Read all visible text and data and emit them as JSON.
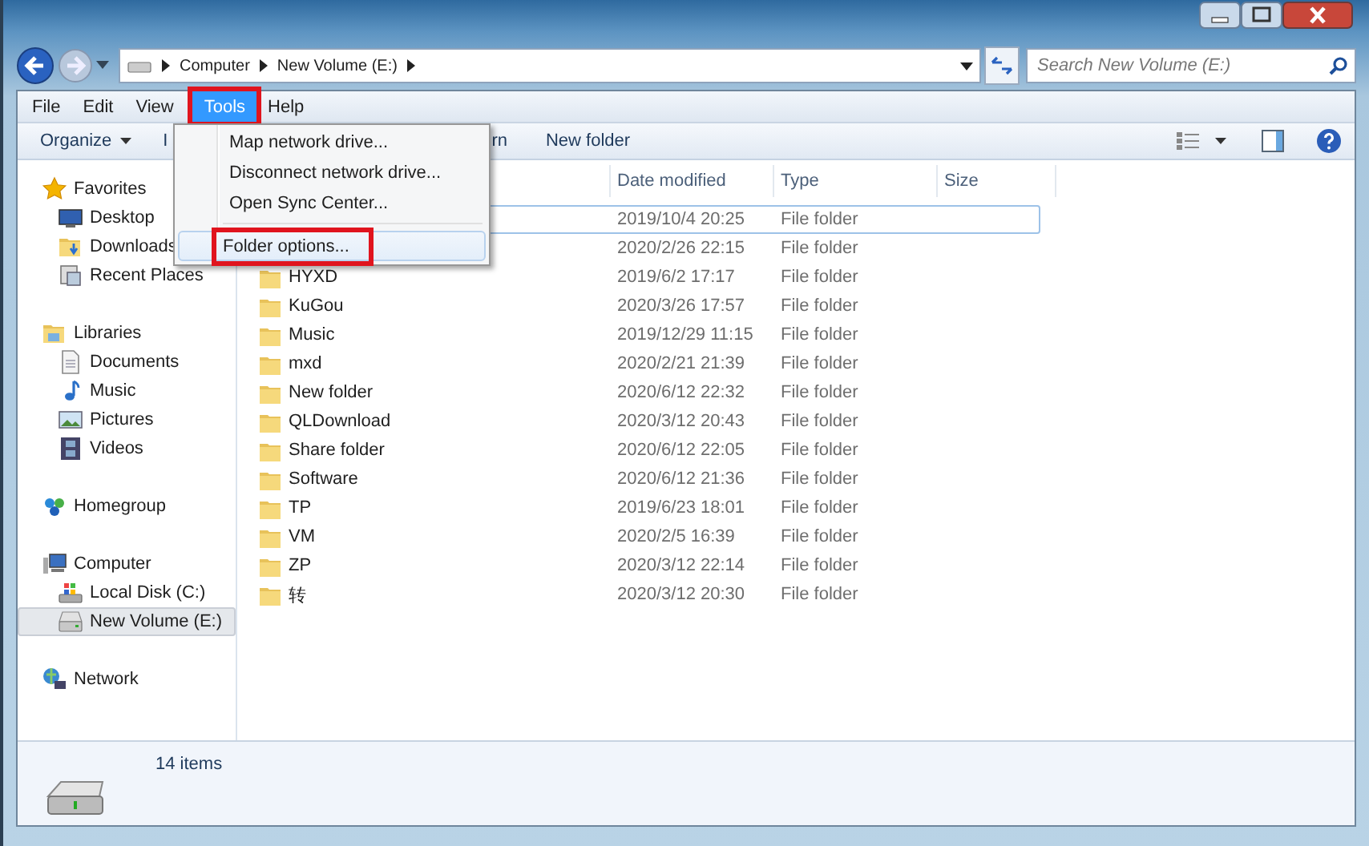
{
  "address_bar": {
    "crumbs": [
      "Computer",
      "New Volume (E:)"
    ]
  },
  "search": {
    "placeholder": "Search New Volume (E:)"
  },
  "menu_bar": [
    {
      "label": "File",
      "selected": false,
      "outlined": false
    },
    {
      "label": "View",
      "selected": false,
      "outlined": false
    },
    {
      "label": "Tools",
      "selected": true,
      "outlined": true
    },
    {
      "label": "Help",
      "selected": false,
      "outlined": false
    }
  ],
  "menu_bar_extra": {
    "label": "Edit"
  },
  "toolbar": [
    {
      "label": "Organize",
      "kind": "dropdown"
    },
    {
      "label": "I",
      "kind": "plain"
    },
    {
      "label": "rn",
      "kind": "plain"
    },
    {
      "label": "New folder",
      "kind": "plain"
    }
  ],
  "tools_menu": [
    {
      "kind": "item",
      "label": "Map network drive...",
      "highlighted": false,
      "outlined": false
    },
    {
      "kind": "item",
      "label": "Disconnect network drive...",
      "highlighted": false,
      "outlined": false
    },
    {
      "kind": "item",
      "label": "Open Sync Center...",
      "highlighted": false,
      "outlined": false
    },
    {
      "kind": "separator"
    },
    {
      "kind": "item",
      "label": "Folder options...",
      "highlighted": true,
      "outlined": true
    }
  ],
  "sidebar": [
    {
      "label": "Favorites",
      "selected": false,
      "children": [
        {
          "label": "Desktop",
          "selected": false
        },
        {
          "label": "Downloads",
          "selected": false
        },
        {
          "label": "Recent Places",
          "selected": false
        }
      ]
    },
    {
      "label": "Libraries",
      "selected": false,
      "children": [
        {
          "label": "Documents",
          "selected": false
        },
        {
          "label": "Music",
          "selected": false
        },
        {
          "label": "Pictures",
          "selected": false
        },
        {
          "label": "Videos",
          "selected": false
        }
      ]
    },
    {
      "label": "Homegroup",
      "selected": false
    },
    {
      "label": "Computer",
      "selected": false,
      "children": [
        {
          "label": "Local Disk (C:)",
          "selected": false
        },
        {
          "label": "New Volume (E:)",
          "selected": true
        }
      ]
    },
    {
      "label": "Network",
      "selected": false
    }
  ],
  "table": {
    "columns": [
      "Date modified",
      "Type",
      "Size"
    ],
    "rows": [
      {
        "modified": "2019/10/4 20:25",
        "type": "File folder",
        "selected": true
      },
      {
        "modified": "2020/2/26 22:15",
        "type": "File folder",
        "selected": false
      },
      {
        "name": "HYXD",
        "modified": "2019/6/2 17:17",
        "type": "File folder",
        "selected": false
      },
      {
        "name": "KuGou",
        "modified": "2020/3/26 17:57",
        "type": "File folder",
        "selected": false
      },
      {
        "name": "Music",
        "modified": "2019/12/29 11:15",
        "type": "File folder",
        "selected": false
      },
      {
        "name": "mxd",
        "modified": "2020/2/21 21:39",
        "type": "File folder",
        "selected": false
      },
      {
        "name": "New folder",
        "modified": "2020/6/12 22:32",
        "type": "File folder",
        "selected": false
      },
      {
        "name": "QLDownload",
        "modified": "2020/3/12 20:43",
        "type": "File folder",
        "selected": false
      },
      {
        "name": "Share folder",
        "modified": "2020/6/12 22:05",
        "type": "File folder",
        "selected": false
      },
      {
        "name": "Software",
        "modified": "2020/6/12 21:36",
        "type": "File folder",
        "selected": false
      },
      {
        "name": "TP",
        "modified": "2019/6/23 18:01",
        "type": "File folder",
        "selected": false
      },
      {
        "name": "VM",
        "modified": "2020/2/5 16:39",
        "type": "File folder",
        "selected": false
      },
      {
        "name": "ZP",
        "modified": "2020/3/12 22:14",
        "type": "File folder",
        "selected": false
      },
      {
        "name": "转",
        "modified": "2020/3/12 20:30",
        "type": "File folder",
        "selected": false
      }
    ]
  },
  "status_bar": {
    "text": "14 items"
  }
}
